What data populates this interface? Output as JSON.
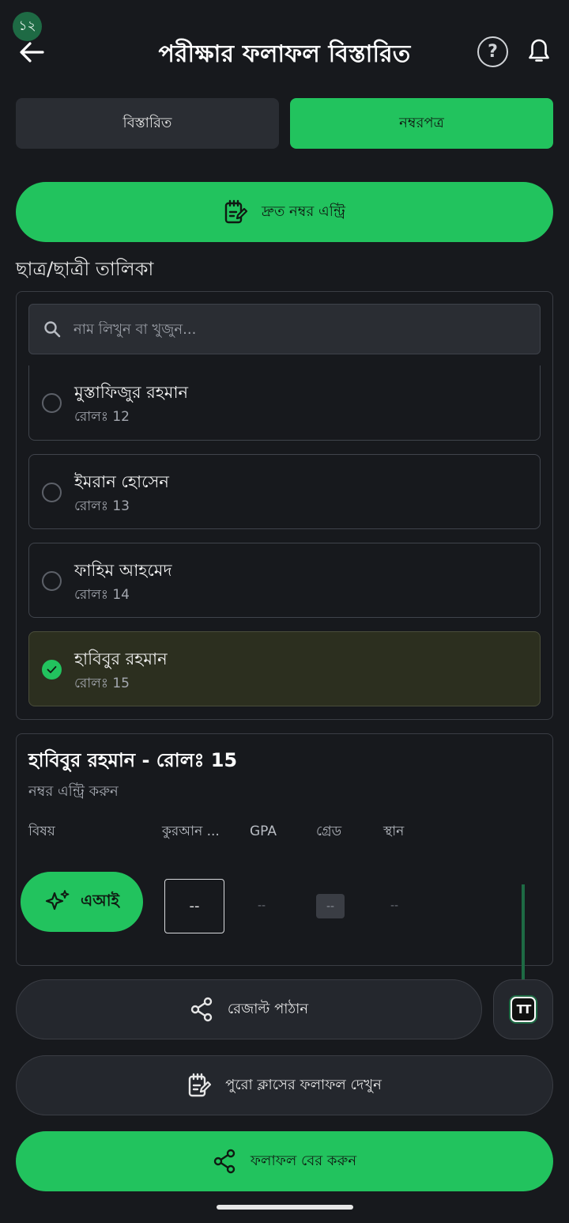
{
  "status": {
    "badge": "১২"
  },
  "header": {
    "title": "পরীক্ষার ফলাফল বিস্তারিত",
    "help_glyph": "?"
  },
  "tabs": [
    {
      "label": "বিস্তারিত",
      "active": false
    },
    {
      "label": "নম্বরপত্র",
      "active": true
    }
  ],
  "quick_entry": {
    "label": "দ্রুত নম্বর এন্ট্রি"
  },
  "student_section": {
    "label": "ছাত্র/ছাত্রী তালিকা",
    "search_placeholder": "নাম লিখুন বা খুজুন..."
  },
  "students": [
    {
      "name": "মুস্তাফিজুর রহমান",
      "roll": "রোলঃ 12",
      "selected": false
    },
    {
      "name": "ইমরান হোসেন",
      "roll": "রোলঃ 13",
      "selected": false
    },
    {
      "name": "ফাহিম আহমেদ",
      "roll": "রোলঃ 14",
      "selected": false
    },
    {
      "name": "হাবিবুর রহমান",
      "roll": "রোলঃ 15",
      "selected": true
    }
  ],
  "entry": {
    "title": "হাবিবুর রহমান - রোলঃ 15",
    "subtitle": "নম্বর এন্ট্রি করুন",
    "columns": [
      "বিষয়",
      "কুরআন ...",
      "GPA",
      "গ্রেড",
      "স্থান"
    ],
    "ai_label": "এআই",
    "mark_value": "--",
    "gpa_value": "--",
    "grade_value": "--",
    "rank_value": "--"
  },
  "actions": {
    "send_result": "রেজাল্ট পাঠান",
    "text_size_glyph": "TT",
    "view_class_results": "পুরো ক্লাসের ফলাফল দেখুন",
    "export_results": "ফলাফল বের করুন"
  },
  "colors": {
    "accent": "#22c35e",
    "background": "#17191d",
    "surface": "#24272d"
  }
}
